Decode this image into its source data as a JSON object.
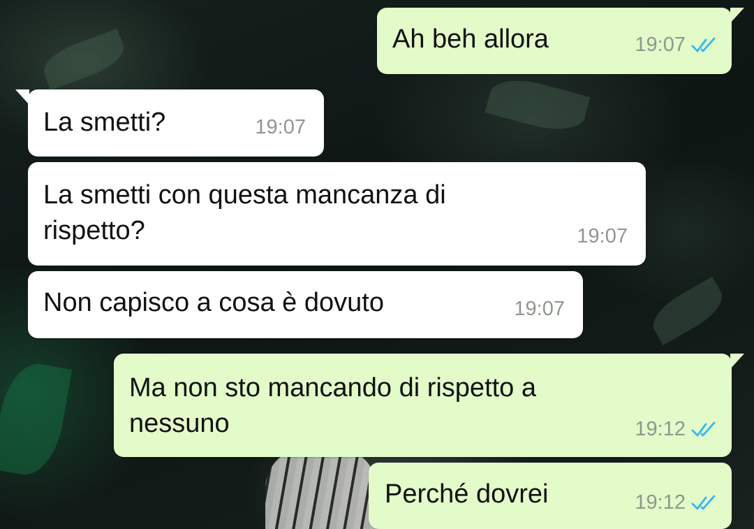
{
  "chat": {
    "messages": [
      {
        "direction": "outgoing",
        "text": "Ah beh allora",
        "time": "19:07",
        "status": "read",
        "status_icon": "double-check-icon",
        "tick_color": "#34b7f1"
      },
      {
        "direction": "incoming",
        "text": "La smetti?",
        "time": "19:07"
      },
      {
        "direction": "incoming",
        "text": "La smetti con questa mancanza di\nrispetto?",
        "time": "19:07"
      },
      {
        "direction": "incoming",
        "text": "Non capisco a cosa è dovuto",
        "time": "19:07"
      },
      {
        "direction": "outgoing",
        "text": "Ma non sto mancando di rispetto a\nnessuno",
        "time": "19:12",
        "status": "read",
        "status_icon": "double-check-icon",
        "tick_color": "#34b7f1"
      },
      {
        "direction": "outgoing",
        "text": "Perché dovrei",
        "time": "19:12",
        "status": "read",
        "status_icon": "double-check-icon",
        "tick_color": "#34b7f1"
      }
    ]
  },
  "colors": {
    "outgoing_bubble": "#e2fbc9",
    "incoming_bubble": "#ffffff",
    "timestamp": "#8f978d",
    "read_ticks": "#34b7f1"
  }
}
